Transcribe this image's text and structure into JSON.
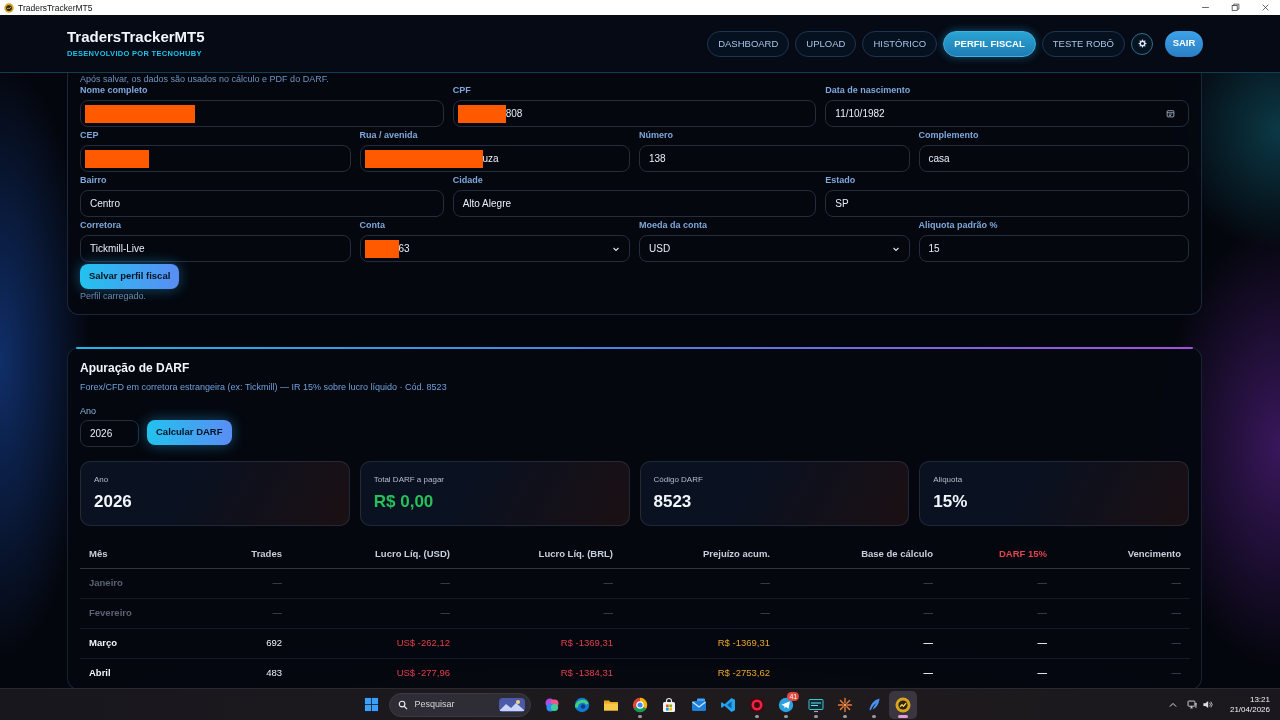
{
  "window": {
    "title": "TradersTrackerMT5"
  },
  "navbar": {
    "brand": "TradersTrackerMT5",
    "tagline": "DESENVOLVIDO POR TECNOHUBY",
    "tabs": [
      {
        "label": "DASHBOARD",
        "selected": false
      },
      {
        "label": "UPLOAD",
        "selected": false
      },
      {
        "label": "HISTÓRICO",
        "selected": false
      },
      {
        "label": "PERFIL FISCAL",
        "selected": true
      },
      {
        "label": "TESTE ROBÔ",
        "selected": false
      }
    ],
    "logout": "SAIR"
  },
  "profile": {
    "note": "Após salvar, os dados são usados no cálculo e PDF do DARF.",
    "rows": [
      {
        "fields": [
          {
            "label": "Nome completo",
            "kind": "text",
            "redacted": true
          },
          {
            "label": "CPF",
            "kind": "text",
            "redacted": true,
            "value": "808"
          },
          {
            "label": "Data de nascimento",
            "kind": "date",
            "redacted": false,
            "value": "11/10/1982"
          }
        ]
      },
      {
        "fields": [
          {
            "label": "CEP",
            "kind": "text",
            "redacted": true
          },
          {
            "label": "Rua / avenida",
            "kind": "text",
            "redacted": true,
            "value": "uza"
          },
          {
            "label": "Número",
            "kind": "text",
            "redacted": false,
            "value": "138"
          },
          {
            "label": "Complemento",
            "kind": "text",
            "redacted": false,
            "value": "casa"
          }
        ]
      },
      {
        "fields": [
          {
            "label": "Bairro",
            "kind": "text",
            "redacted": false,
            "value": "Centro"
          },
          {
            "label": "Cidade",
            "kind": "text",
            "redacted": false,
            "value": "Alto Alegre"
          },
          {
            "label": "Estado",
            "kind": "text",
            "redacted": false,
            "value": "SP"
          }
        ]
      },
      {
        "fields": [
          {
            "label": "Corretora",
            "kind": "text",
            "redacted": false,
            "value": "Tickmill-Live"
          },
          {
            "label": "Conta",
            "kind": "select",
            "redacted": true,
            "value": "63"
          },
          {
            "label": "Moeda da conta",
            "kind": "select",
            "redacted": false,
            "value": "USD"
          },
          {
            "label": "Aliquota padrão %",
            "kind": "text",
            "redacted": false,
            "value": "15"
          }
        ]
      }
    ],
    "save_button": "Salvar perfil fiscal",
    "status": "Perfil carregado."
  },
  "darf": {
    "title": "Apuração de DARF",
    "subtitle": "Forex/CFD em corretora estrangeira (ex: Tickmill) — IR 15% sobre lucro líquido · Cód. 8523",
    "year": {
      "label": "Ano",
      "value": "2026"
    },
    "button": "Calcular DARF",
    "stats": [
      {
        "label": "Ano",
        "value": "2026",
        "kind": "plain"
      },
      {
        "label": "Total DARF a pagar",
        "value": "R$ 0,00",
        "kind": "amount"
      },
      {
        "label": "Código DARF",
        "value": "8523",
        "kind": "plain"
      },
      {
        "label": "Aliquota",
        "value": "15%",
        "kind": "plain"
      }
    ],
    "table": {
      "columns": [
        {
          "label": "Mês",
          "kind": "month",
          "highlight": false
        },
        {
          "label": "Trades",
          "kind": "count",
          "highlight": false
        },
        {
          "label": "Lucro Líq. (USD)",
          "kind": "loss",
          "highlight": false
        },
        {
          "label": "Lucro Líq. (BRL)",
          "kind": "loss",
          "highlight": false
        },
        {
          "label": "Prejuízo acum.",
          "kind": "carry",
          "highlight": false
        },
        {
          "label": "Base de cálculo",
          "kind": "dash",
          "highlight": false
        },
        {
          "label": "DARF 15%",
          "kind": "dash",
          "highlight": true
        },
        {
          "label": "Vencimento",
          "kind": "faint",
          "highlight": false
        }
      ],
      "rows": [
        {
          "muted": true,
          "cells": [
            "Janeiro",
            "—",
            "—",
            "—",
            "—",
            "—",
            "—",
            "—"
          ]
        },
        {
          "muted": true,
          "cells": [
            "Fevereiro",
            "—",
            "—",
            "—",
            "—",
            "—",
            "—",
            "—"
          ]
        },
        {
          "muted": false,
          "cells": [
            "Março",
            "692",
            "US$ -262,12",
            "R$ -1369,31",
            "R$ -1369,31",
            "—",
            "—",
            "—"
          ]
        },
        {
          "muted": false,
          "cells": [
            "Abril",
            "483",
            "US$ -277,96",
            "R$ -1384,31",
            "R$ -2753,62",
            "—",
            "—",
            "—"
          ]
        }
      ]
    }
  },
  "taskbar": {
    "search": {
      "placeholder": "Pesquisar"
    },
    "apps": [
      {
        "kind": "blob",
        "running": false,
        "selected": false
      },
      {
        "kind": "swirl",
        "running": false,
        "selected": false
      },
      {
        "kind": "folder",
        "running": false,
        "selected": false
      },
      {
        "kind": "ring",
        "running": true,
        "selected": false
      },
      {
        "kind": "bag",
        "running": false,
        "selected": false
      },
      {
        "kind": "envelope",
        "running": false,
        "selected": false
      },
      {
        "kind": "ribbon",
        "running": false,
        "selected": false
      },
      {
        "kind": "redring",
        "running": true,
        "selected": false
      },
      {
        "kind": "plane",
        "running": true,
        "selected": false,
        "badge": "41"
      },
      {
        "kind": "monitor",
        "running": true,
        "selected": false
      },
      {
        "kind": "sunburst",
        "running": true,
        "selected": false
      },
      {
        "kind": "feather",
        "running": true,
        "selected": false
      },
      {
        "kind": "emblem",
        "running": true,
        "selected": true
      }
    ],
    "time": "13:21",
    "date": "21/04/2026"
  }
}
